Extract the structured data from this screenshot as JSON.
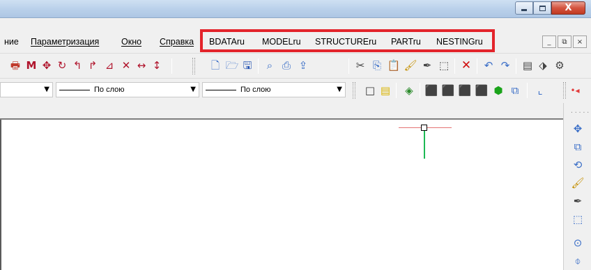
{
  "window": {
    "controls": {
      "minimize_icon": "minimize-icon",
      "maximize_icon": "maximize-icon",
      "close_label": "X"
    }
  },
  "menu": {
    "items": [
      {
        "label": "ние",
        "underline": false
      },
      {
        "label": "Параметризация",
        "underline": true
      },
      {
        "label": "Окно",
        "underline": true
      },
      {
        "label": "Справка",
        "underline": true
      },
      {
        "label": "BDATAru",
        "underline": false
      },
      {
        "label": "MODELru",
        "underline": false
      },
      {
        "label": "STRUCTUREru",
        "underline": false
      },
      {
        "label": "PARTru",
        "underline": false
      },
      {
        "label": "NESTINGru",
        "underline": false
      }
    ],
    "highlight_color": "#e3242b",
    "mdi_controls": [
      "_",
      "⧉",
      "×"
    ]
  },
  "properties": {
    "linetype_value": "По слою",
    "lineweight_value": "По слою"
  },
  "colors": {
    "accent_red": "#e3242b",
    "crosshair_x": "#e57373",
    "crosshair_y": "#1db954"
  }
}
